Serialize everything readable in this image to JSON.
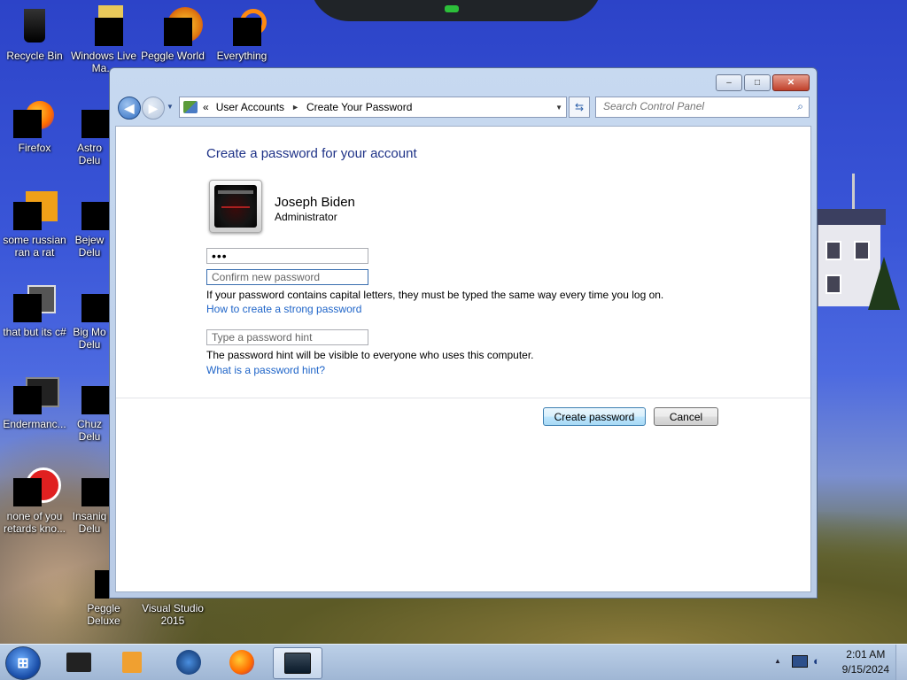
{
  "desktop": {
    "icons": [
      {
        "label": "Recycle Bin"
      },
      {
        "label": "Windows Live\nMa..."
      },
      {
        "label": "Peggle World"
      },
      {
        "label": "Everything"
      },
      {
        "label": "Firefox"
      },
      {
        "label": "Astro\nDelu"
      },
      {
        "label": "some russian\nran a rat"
      },
      {
        "label": "Bejew\nDelu"
      },
      {
        "label": "that but its c#"
      },
      {
        "label": "Big Mo\nDelu"
      },
      {
        "label": "Endermanc..."
      },
      {
        "label": "Chuz\nDelu"
      },
      {
        "label": "none of you\nretards kno..."
      },
      {
        "label": "Insaniq\nDelu"
      },
      {
        "label": "Peggle Deluxe"
      },
      {
        "label": "Visual Studio\n2015"
      }
    ]
  },
  "window": {
    "caption_buttons": {
      "minimize": "–",
      "maximize": "□",
      "close": "✕"
    },
    "breadcrumb": {
      "prefix": "«",
      "items": [
        "User Accounts",
        "Create Your Password"
      ],
      "separator": "►"
    },
    "search": {
      "placeholder": "Search Control Panel"
    },
    "icons": {
      "back": "back-arrow-icon",
      "forward": "forward-arrow-icon",
      "refresh": "refresh-icon",
      "search": "magnifier-icon",
      "control_panel": "control-panel-icon"
    }
  },
  "form": {
    "heading": "Create a password for your account",
    "user": {
      "name": "Joseph Biden",
      "role": "Administrator"
    },
    "password_value": "•••",
    "confirm_placeholder": "Confirm new password",
    "caps_note": "If your password contains capital letters, they must be typed the same way every time you log on.",
    "strong_link": "How to create a strong password",
    "hint_placeholder": "Type a password hint",
    "hint_note": "The password hint will be visible to everyone who uses this computer.",
    "hint_link": "What is a password hint?",
    "create_button": "Create password",
    "cancel_button": "Cancel"
  },
  "taskbar": {
    "start_glyph": "⊞",
    "clock": {
      "time": "2:01 AM",
      "date": "9/15/2024"
    },
    "colors": {
      "accent": "#1e3287",
      "link": "#1e64c8"
    }
  }
}
